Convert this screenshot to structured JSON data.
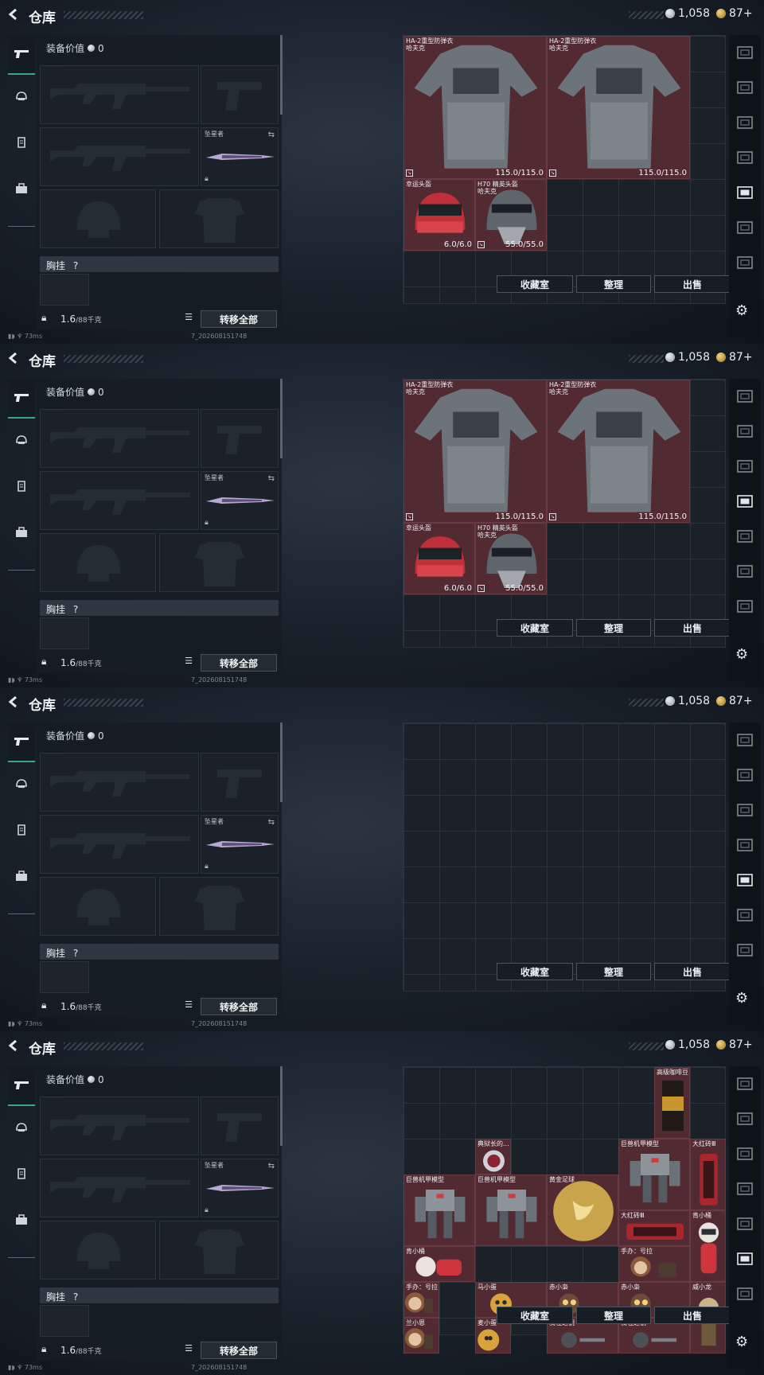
{
  "title": "仓库",
  "currency": {
    "coins": "1,058",
    "tokens": "87+"
  },
  "loadout": {
    "value_label": "装备价值",
    "value": "0",
    "melee_name": "坠星者",
    "chest_label": "胸挂",
    "chest_help": "?",
    "weight_value": "1.6",
    "weight_max": "/88千克",
    "transfer_all": "转移全部"
  },
  "status": {
    "ping": "73ms",
    "build": "7_202608151748"
  },
  "grid_buttons": {
    "collection": "收藏室",
    "sort": "整理",
    "sell": "出售"
  },
  "sidebar_icons": [
    "gun-icon",
    "helmet-icon",
    "armor-icon",
    "bag-icon"
  ],
  "vault_icons": [
    "vault-tab-0-icon",
    "vault-tab-1-icon",
    "vault-tab-2-icon",
    "vault-tab-3-icon",
    "vault-tab-4-icon",
    "vault-tab-5-icon",
    "vault-tab-6-icon"
  ],
  "panels": [
    {
      "active_vault_tab": 4,
      "items": [
        {
          "name": "HA-2重型防弹衣",
          "sub": "哈夫克",
          "dur": "115.0/115.0",
          "kind": "armor",
          "col": 0,
          "row": 0,
          "w": 4,
          "h": 4
        },
        {
          "name": "HA-2重型防弹衣",
          "sub": "哈夫克",
          "dur": "115.0/115.0",
          "kind": "armor",
          "col": 4,
          "row": 0,
          "w": 4,
          "h": 4
        },
        {
          "name": "幸运头盔",
          "sub": "",
          "dur": "6.0/6.0",
          "kind": "helmet-red",
          "col": 0,
          "row": 4,
          "w": 2,
          "h": 2
        },
        {
          "name": "H70 精英头盔",
          "sub": "哈夫克",
          "dur": "55.0/55.0",
          "kind": "helmet-grey",
          "col": 2,
          "row": 4,
          "w": 2,
          "h": 2
        }
      ]
    },
    {
      "active_vault_tab": 3,
      "items": [
        {
          "name": "HA-2重型防弹衣",
          "sub": "哈夫克",
          "dur": "115.0/115.0",
          "kind": "armor",
          "col": 0,
          "row": 0,
          "w": 4,
          "h": 4
        },
        {
          "name": "HA-2重型防弹衣",
          "sub": "哈夫克",
          "dur": "115.0/115.0",
          "kind": "armor",
          "col": 4,
          "row": 0,
          "w": 4,
          "h": 4
        },
        {
          "name": "幸运头盔",
          "sub": "",
          "dur": "6.0/6.0",
          "kind": "helmet-red",
          "col": 0,
          "row": 4,
          "w": 2,
          "h": 2
        },
        {
          "name": "H70 精英头盔",
          "sub": "哈夫克",
          "dur": "55.0/55.0",
          "kind": "helmet-grey",
          "col": 2,
          "row": 4,
          "w": 2,
          "h": 2
        }
      ]
    },
    {
      "active_vault_tab": 4,
      "items": []
    },
    {
      "active_vault_tab": 5,
      "items": [
        {
          "name": "高级咖啡豆",
          "sub": "",
          "dur": "",
          "kind": "coffee",
          "col": 7,
          "row": 0,
          "w": 1,
          "h": 2
        },
        {
          "name": "典狱长的...",
          "sub": "",
          "dur": "",
          "kind": "badge",
          "col": 2,
          "row": 2,
          "w": 1,
          "h": 1
        },
        {
          "name": "巨兽机甲模型",
          "sub": "",
          "dur": "",
          "kind": "mech",
          "col": 6,
          "row": 2,
          "w": 2,
          "h": 2
        },
        {
          "name": "大红砖Ⅲ",
          "sub": "",
          "dur": "",
          "kind": "brick-v",
          "col": 8,
          "row": 2,
          "w": 1,
          "h": 2
        },
        {
          "name": "巨兽机甲模型",
          "sub": "",
          "dur": "",
          "kind": "mech",
          "col": 0,
          "row": 3,
          "w": 2,
          "h": 2
        },
        {
          "name": "巨兽机甲模型",
          "sub": "",
          "dur": "",
          "kind": "mech",
          "col": 2,
          "row": 3,
          "w": 2,
          "h": 2
        },
        {
          "name": "黄金足球",
          "sub": "",
          "dur": "",
          "kind": "ball",
          "col": 4,
          "row": 3,
          "w": 2,
          "h": 2
        },
        {
          "name": "大红砖Ⅲ",
          "sub": "",
          "dur": "",
          "kind": "brick-h",
          "col": 6,
          "row": 4,
          "w": 2,
          "h": 1
        },
        {
          "name": "肯小桶",
          "sub": "",
          "dur": "",
          "kind": "doll",
          "col": 8,
          "row": 4,
          "w": 1,
          "h": 2
        },
        {
          "name": "肯小桶",
          "sub": "",
          "dur": "",
          "kind": "doll-h",
          "col": 0,
          "row": 5,
          "w": 2,
          "h": 1
        },
        {
          "name": "手办：号拉",
          "sub": "",
          "dur": "",
          "kind": "figure",
          "col": 6,
          "row": 5,
          "w": 2,
          "h": 1
        },
        {
          "name": "手办：号拉",
          "sub": "",
          "dur": "",
          "kind": "figure",
          "col": 0,
          "row": 6,
          "w": 1,
          "h": 1
        },
        {
          "name": "马小蛋",
          "sub": "",
          "dur": "",
          "kind": "egg",
          "col": 2,
          "row": 6,
          "w": 2,
          "h": 1
        },
        {
          "name": "赤小枭",
          "sub": "",
          "dur": "",
          "kind": "owl",
          "col": 4,
          "row": 6,
          "w": 2,
          "h": 1
        },
        {
          "name": "赤小枭",
          "sub": "",
          "dur": "",
          "kind": "owl",
          "col": 6,
          "row": 6,
          "w": 2,
          "h": 1
        },
        {
          "name": "威小龙",
          "sub": "",
          "dur": "",
          "kind": "dragon",
          "col": 8,
          "row": 6,
          "w": 1,
          "h": 2
        },
        {
          "name": "兰小恩",
          "sub": "",
          "dur": "",
          "kind": "figure",
          "col": 0,
          "row": 7,
          "w": 1,
          "h": 1
        },
        {
          "name": "麦小蛋",
          "sub": "",
          "dur": "",
          "kind": "egg",
          "col": 2,
          "row": 7,
          "w": 1,
          "h": 1
        },
        {
          "name": "骑牲之钥",
          "sub": "",
          "dur": "",
          "kind": "key",
          "col": 4,
          "row": 7,
          "w": 2,
          "h": 1
        },
        {
          "name": "骑牲之钥",
          "sub": "",
          "dur": "",
          "kind": "key",
          "col": 6,
          "row": 7,
          "w": 2,
          "h": 1
        }
      ]
    }
  ]
}
